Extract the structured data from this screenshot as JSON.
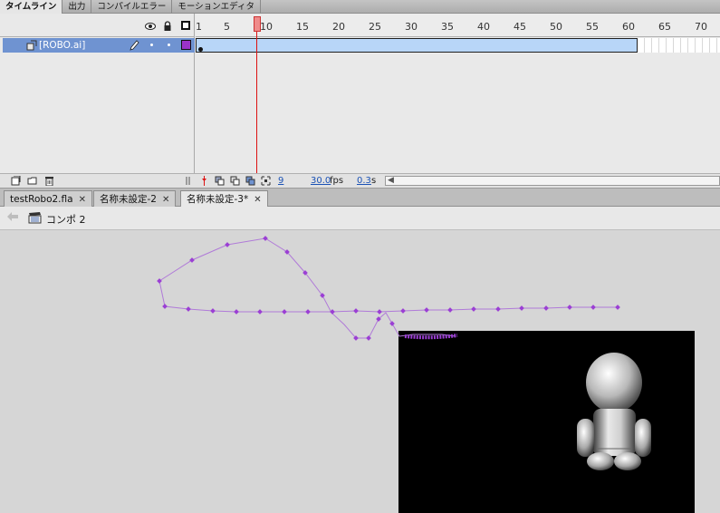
{
  "panel_tabs": [
    "タイムライン",
    "出力",
    "コンパイルエラー",
    "モーションエディタ"
  ],
  "timeline": {
    "ruler_labels": [
      "1",
      "5",
      "10",
      "15",
      "20",
      "25",
      "30",
      "35",
      "40",
      "45",
      "50",
      "55",
      "60",
      "65",
      "70"
    ],
    "layer_name": "[ROBO.ai]",
    "layer_color": "#9a33c8",
    "current_frame": "9",
    "fps_value": "30.0",
    "fps_unit": "fps",
    "time_value": "0.3",
    "time_unit": "s"
  },
  "doc_tabs": [
    {
      "label": "testRobo2.fla"
    },
    {
      "label": "名称未設定-2"
    },
    {
      "label": "名称未設定-3*"
    }
  ],
  "close_glyph": "✕",
  "breadcrumb": {
    "label": "コンポ 2"
  },
  "colors": {
    "accent_selection": "#6f93d1",
    "tween_span": "#b8d6f8",
    "playhead": "#d11111",
    "motion_path": "#9b3fd4",
    "stage_bg": "#000000"
  }
}
